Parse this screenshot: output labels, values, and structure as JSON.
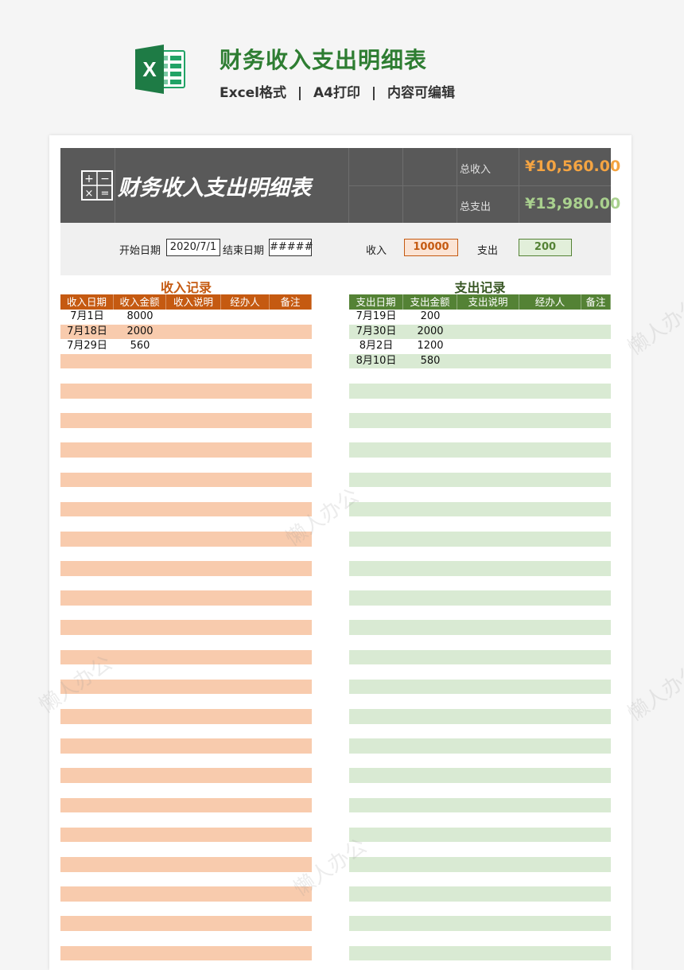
{
  "header": {
    "title": "财务收入支出明细表",
    "subtitle_parts": [
      "Excel格式",
      "A4打印",
      "内容可编辑"
    ],
    "separator": "|",
    "icon": "excel-icon"
  },
  "sheet": {
    "banner_title": "财务收入支出明细表",
    "banner_icon": "calculator-icon",
    "summary": {
      "income_label": "总收入",
      "income_value": "¥10,560.00",
      "expense_label": "总支出",
      "expense_value": "¥13,980.00"
    },
    "filters": {
      "start_label": "开始日期",
      "start_value": "2020/7/1",
      "end_label": "结束日期",
      "end_value": "#####",
      "income_label": "收入",
      "income_value": "10000",
      "expense_label": "支出",
      "expense_value": "200"
    },
    "income": {
      "title": "收入记录",
      "columns": [
        "收入日期",
        "收入金额",
        "收入说明",
        "经办人",
        "备注"
      ],
      "rows": [
        [
          "7月1日",
          "8000",
          "",
          "",
          ""
        ],
        [
          "7月18日",
          "2000",
          "",
          "",
          ""
        ],
        [
          "7月29日",
          "560",
          "",
          "",
          ""
        ]
      ]
    },
    "expense": {
      "title": "支出记录",
      "columns": [
        "支出日期",
        "支出金额",
        "支出说明",
        "经办人",
        "备注"
      ],
      "rows": [
        [
          "7月19日",
          "200",
          "",
          "",
          ""
        ],
        [
          "7月30日",
          "2000",
          "",
          "",
          ""
        ],
        [
          "8月2日",
          "1200",
          "",
          "",
          ""
        ],
        [
          "8月10日",
          "580",
          "",
          "",
          ""
        ]
      ]
    },
    "watermark_text": "懒人办公"
  },
  "colors": {
    "income_accent": "#c55a11",
    "income_stripe": "#f8cbad",
    "expense_accent": "#548235",
    "expense_stripe": "#d9ead3",
    "income_total": "#f4a442",
    "expense_total": "#a9d08e"
  }
}
